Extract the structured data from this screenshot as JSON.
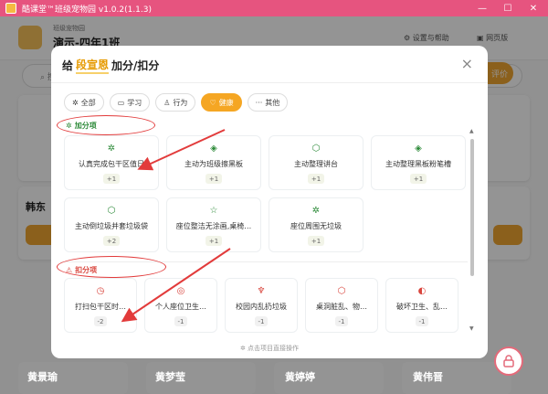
{
  "window": {
    "title": "酷课堂™班级宠物园 v1.0.2(1.1.3)",
    "minimize": "—",
    "maximize": "☐",
    "close": "✕"
  },
  "background": {
    "subtitle": "班级宠物园",
    "class_name": "演示-四年1班",
    "settings_label": "设置与帮助",
    "web_label": "网页版",
    "search_placeholder": "搜",
    "eval_label": "评价",
    "card_names": [
      "韩东",
      "黄景瑜",
      "黄梦莹",
      "黄婷婷",
      "黄伟晋"
    ]
  },
  "modal": {
    "prefix": "给",
    "student": "段宣恩",
    "suffix": "加分/扣分",
    "close_icon": "×",
    "chips": [
      {
        "icon": "✲",
        "label": "全部",
        "active": false
      },
      {
        "icon": "▭",
        "label": "学习",
        "active": false
      },
      {
        "icon": "♙",
        "label": "行为",
        "active": false
      },
      {
        "icon": "♡",
        "label": "健康",
        "active": true
      },
      {
        "icon": "···",
        "label": "其他",
        "active": false
      }
    ],
    "add_section": {
      "icon": "✲",
      "label": "加分项"
    },
    "add_items": [
      {
        "icon": "✲",
        "label": "认真完成包干区值日",
        "score": "+1"
      },
      {
        "icon": "◈",
        "label": "主动为班级擦黑板",
        "score": "+1"
      },
      {
        "icon": "⬡",
        "label": "主动整理讲台",
        "score": "+1"
      },
      {
        "icon": "◈",
        "label": "主动整理黑板粉笔槽",
        "score": "+1"
      },
      {
        "icon": "⬡",
        "label": "主动倒垃圾并套垃圾袋",
        "score": "+2"
      },
      {
        "icon": "☆",
        "label": "座位整洁无涂画,桌椅…",
        "score": "+1"
      },
      {
        "icon": "✲",
        "label": "座位周围无垃圾",
        "score": "+1"
      }
    ],
    "sub_section": {
      "icon": "⚠",
      "label": "扣分项"
    },
    "sub_items": [
      {
        "icon": "◷",
        "label": "打扫包干区时…",
        "score": "-2"
      },
      {
        "icon": "◎",
        "label": "个人座位卫生…",
        "score": "-1"
      },
      {
        "icon": "♆",
        "label": "校园内乱扔垃圾",
        "score": "-1"
      },
      {
        "icon": "⬡",
        "label": "桌洞脏乱、物…",
        "score": "-1"
      },
      {
        "icon": "◐",
        "label": "破坏卫生、乱…",
        "score": "-1"
      }
    ],
    "hint": "点击项目直接操作"
  },
  "colors": {
    "titlebar": "#e6547f",
    "accent": "#f5a623",
    "plus": "#2e8b3a",
    "minus": "#d9453d",
    "annotation": "#e23b3b"
  }
}
